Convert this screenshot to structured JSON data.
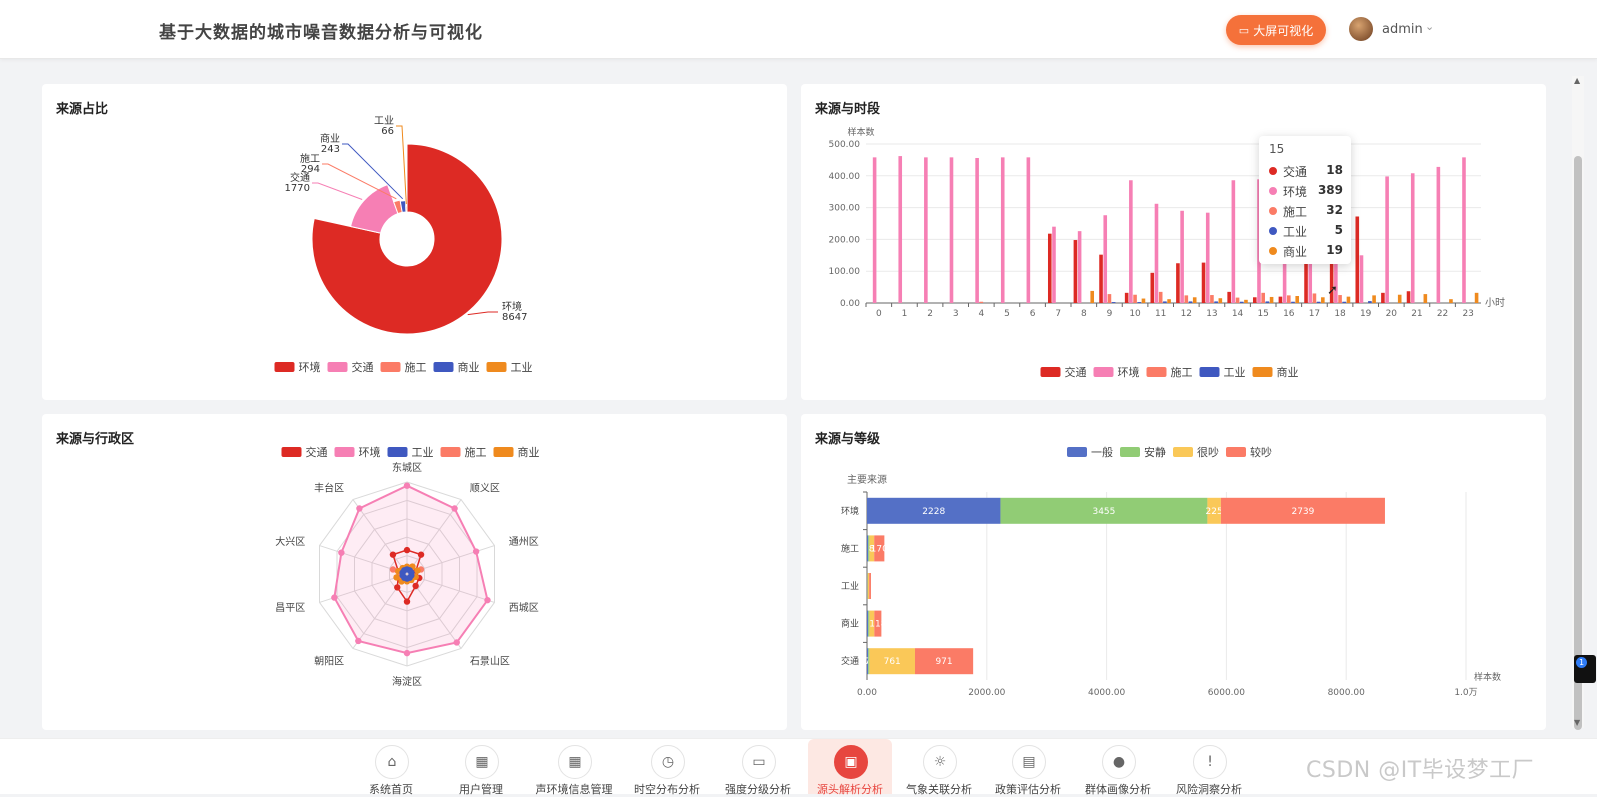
{
  "header": {
    "title": "基于大数据的城市噪音数据分析与可视化",
    "big_screen_label": "大屏可视化",
    "username": "admin"
  },
  "colors": {
    "traffic": "#dd2a24",
    "environment": "#f67fb4",
    "construction": "#fb7b66",
    "industry": "#3f58c0",
    "commerce": "#ef8a1e",
    "accent": "#f5713a",
    "active_nav": "#e7463f"
  },
  "panels": {
    "source_ratio": "来源占比",
    "source_hour": "来源与时段",
    "source_district": "来源与行政区",
    "source_level": "来源与等级"
  },
  "chart_data": [
    {
      "type": "pie",
      "slices": [
        {
          "name": "环境",
          "value": 8647
        },
        {
          "name": "交通",
          "value": 1770
        },
        {
          "name": "施工",
          "value": 294
        },
        {
          "name": "商业",
          "value": 243
        },
        {
          "name": "工业",
          "value": 66
        }
      ],
      "legend": [
        "环境",
        "交通",
        "施工",
        "商业",
        "工业"
      ],
      "legend_position": "bottom"
    },
    {
      "type": "bar",
      "ylabel": "样本数",
      "xlabel": "小时",
      "ylim": [
        0,
        500
      ],
      "yticks": [
        "0.00",
        "100.00",
        "200.00",
        "300.00",
        "400.00",
        "500.00"
      ],
      "categories": [
        "0",
        "1",
        "2",
        "3",
        "4",
        "5",
        "6",
        "7",
        "8",
        "9",
        "10",
        "11",
        "12",
        "13",
        "14",
        "15",
        "16",
        "17",
        "18",
        "19",
        "20",
        "21",
        "22",
        "23"
      ],
      "series": [
        {
          "name": "交通",
          "values": [
            0,
            0,
            0,
            0,
            0,
            0,
            0,
            218,
            198,
            152,
            32,
            95,
            125,
            127,
            35,
            18,
            20,
            175,
            168,
            272,
            32,
            37,
            0,
            0
          ]
        },
        {
          "name": "环境",
          "values": [
            458,
            462,
            458,
            458,
            456,
            458,
            458,
            240,
            226,
            276,
            386,
            312,
            290,
            284,
            386,
            389,
            388,
            377,
            232,
            150,
            398,
            408,
            428,
            458
          ]
        },
        {
          "name": "施工",
          "values": [
            0,
            0,
            0,
            0,
            4,
            0,
            0,
            0,
            0,
            28,
            26,
            35,
            24,
            25,
            17,
            32,
            24,
            30,
            25,
            0,
            0,
            0,
            0,
            0
          ]
        },
        {
          "name": "工业",
          "values": [
            0,
            0,
            0,
            0,
            0,
            0,
            0,
            0,
            0,
            3,
            3,
            5,
            5,
            5,
            4,
            5,
            4,
            4,
            4,
            6,
            0,
            0,
            0,
            0
          ]
        },
        {
          "name": "商业",
          "values": [
            0,
            0,
            0,
            0,
            0,
            0,
            0,
            0,
            38,
            0,
            14,
            12,
            18,
            15,
            10,
            19,
            22,
            18,
            20,
            24,
            26,
            28,
            12,
            32
          ]
        }
      ],
      "legend": [
        "交通",
        "环境",
        "施工",
        "工业",
        "商业"
      ],
      "tooltip": {
        "title": "15",
        "rows": [
          {
            "name": "交通",
            "value": "18"
          },
          {
            "name": "环境",
            "value": "389"
          },
          {
            "name": "施工",
            "value": "32"
          },
          {
            "name": "工业",
            "value": "5"
          },
          {
            "name": "商业",
            "value": "19"
          }
        ]
      }
    },
    {
      "type": "radar",
      "indicators": [
        "东城区",
        "顺义区",
        "通州区",
        "西城区",
        "石景山区",
        "海淀区",
        "朝阳区",
        "昌平区",
        "大兴区",
        "丰台区"
      ],
      "legend": [
        "交通",
        "环境",
        "工业",
        "施工",
        "商业"
      ],
      "series": [
        {
          "name": "交通",
          "values": [
            0.26,
            0.26,
            0.1,
            0.14,
            0.16,
            0.3,
            0.18,
            0.1,
            0.1,
            0.26
          ]
        },
        {
          "name": "环境",
          "values": [
            0.96,
            0.88,
            0.79,
            0.92,
            0.92,
            0.86,
            0.9,
            0.83,
            0.75,
            0.88
          ]
        },
        {
          "name": "工业",
          "values": [
            0.05,
            0.05,
            0.05,
            0.05,
            0.05,
            0.05,
            0.05,
            0.05,
            0.05,
            0.05
          ]
        },
        {
          "name": "施工",
          "values": [
            0.06,
            0.08,
            0.16,
            0.08,
            0.06,
            0.06,
            0.06,
            0.08,
            0.16,
            0.06
          ]
        },
        {
          "name": "商业",
          "values": [
            0.08,
            0.1,
            0.12,
            0.1,
            0.08,
            0.08,
            0.1,
            0.12,
            0.1,
            0.08
          ]
        }
      ]
    },
    {
      "type": "bar",
      "orientation": "horizontal",
      "stacked": true,
      "ylabel": "主要来源",
      "xlabel": "样本数",
      "xlim": [
        0,
        10000
      ],
      "xticks": [
        "0.00",
        "2000.00",
        "4000.00",
        "6000.00",
        "8000.00",
        "1.0万"
      ],
      "categories": [
        "环境",
        "施工",
        "工业",
        "商业",
        "交通"
      ],
      "series": [
        {
          "name": "一般",
          "values": [
            2228,
            20,
            5,
            20,
            20
          ]
        },
        {
          "name": "安静",
          "values": [
            3455,
            20,
            5,
            20,
            20
          ]
        },
        {
          "name": "很吵",
          "values": [
            225,
            80,
            26,
            82,
            761
          ]
        },
        {
          "name": "较吵",
          "values": [
            2739,
            170,
            30,
            118,
            971
          ]
        }
      ],
      "value_labels": [
        [
          "2228",
          "3455",
          "225",
          "2739"
        ],
        [
          "",
          "",
          "8",
          "170"
        ],
        [
          "",
          "",
          "",
          ""
        ],
        [
          "",
          "",
          "",
          "118"
        ],
        [
          "7",
          "",
          "761",
          "971"
        ]
      ],
      "legend": [
        "一般",
        "安静",
        "很吵",
        "较吵"
      ]
    }
  ],
  "nav": [
    {
      "label": "系统首页",
      "icon": "home-icon",
      "glyph": "⌂"
    },
    {
      "label": "用户管理",
      "icon": "grid-icon",
      "glyph": "▦"
    },
    {
      "label": "声环境信息管理",
      "icon": "apps-icon",
      "glyph": "▦"
    },
    {
      "label": "时空分布分析",
      "icon": "clock-icon",
      "glyph": "◷"
    },
    {
      "label": "强度分级分析",
      "icon": "presentation-icon",
      "glyph": "▭"
    },
    {
      "label": "源头解析分析",
      "icon": "source-icon",
      "glyph": "▣"
    },
    {
      "label": "气象关联分析",
      "icon": "sun-icon",
      "glyph": "☼"
    },
    {
      "label": "政策评估分析",
      "icon": "document-icon",
      "glyph": "▤"
    },
    {
      "label": "群体画像分析",
      "icon": "user-icon",
      "glyph": "●"
    },
    {
      "label": "风险洞察分析",
      "icon": "warning-icon",
      "glyph": "!"
    }
  ],
  "watermark": "CSDN @IT毕设梦工厂"
}
